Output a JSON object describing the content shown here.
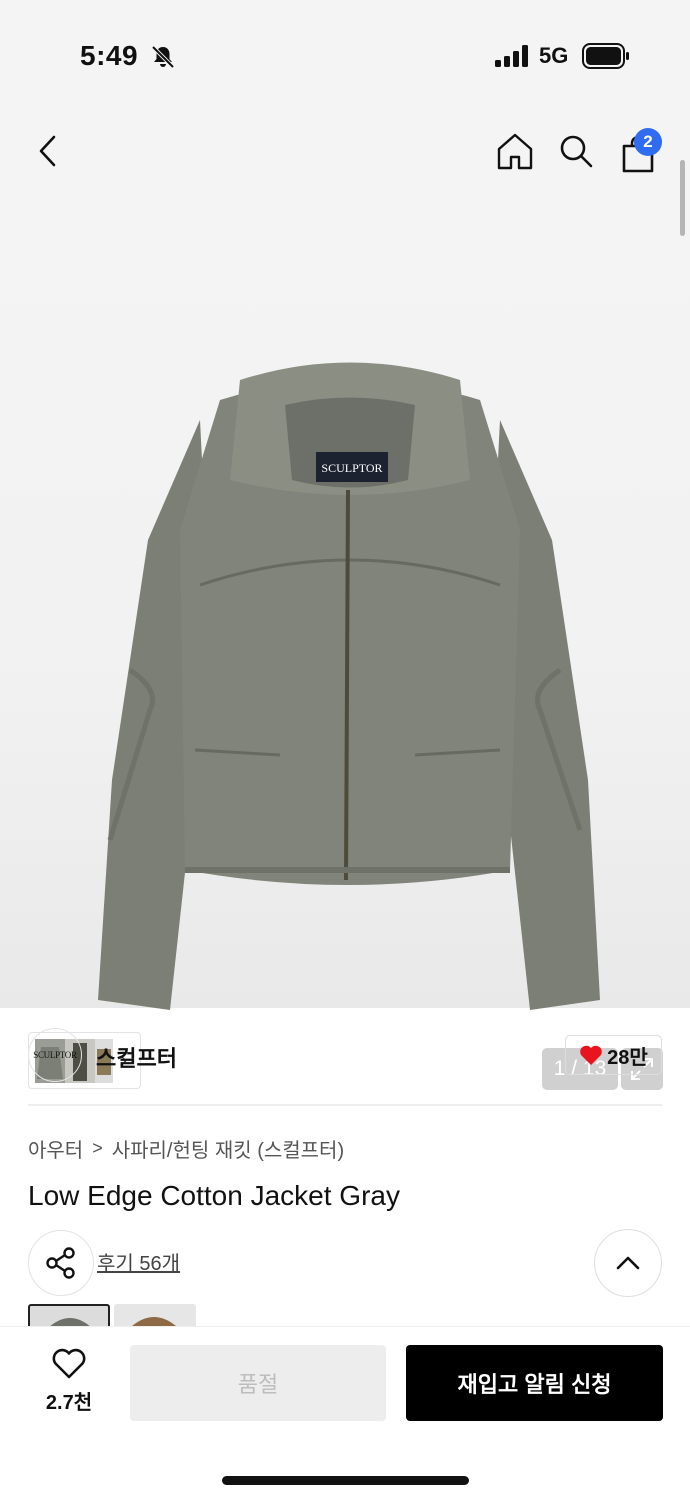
{
  "status_bar": {
    "time": "5:49",
    "network": "5G"
  },
  "nav": {
    "cart_count": "2"
  },
  "gallery": {
    "counter": "1 / 13"
  },
  "brand": {
    "logo_text": "SCULPTOR",
    "name": "스컬프터",
    "likes": "28만"
  },
  "breadcrumb": {
    "level1": "아우터",
    "level2": "사파리/헌팅 재킷 (스컬프터)"
  },
  "product": {
    "title": "Low Edge Cotton Jacket Gray",
    "review_link": "후기 56개",
    "label_text": "SCULPTOR"
  },
  "bottom": {
    "wish_count": "2.7천",
    "soldout_label": "품절",
    "restock_label": "재입고 알림 신청"
  },
  "colors": {
    "badge": "#2f6cf0",
    "heart": "#e8141e",
    "jacket": "#7b7f75"
  }
}
